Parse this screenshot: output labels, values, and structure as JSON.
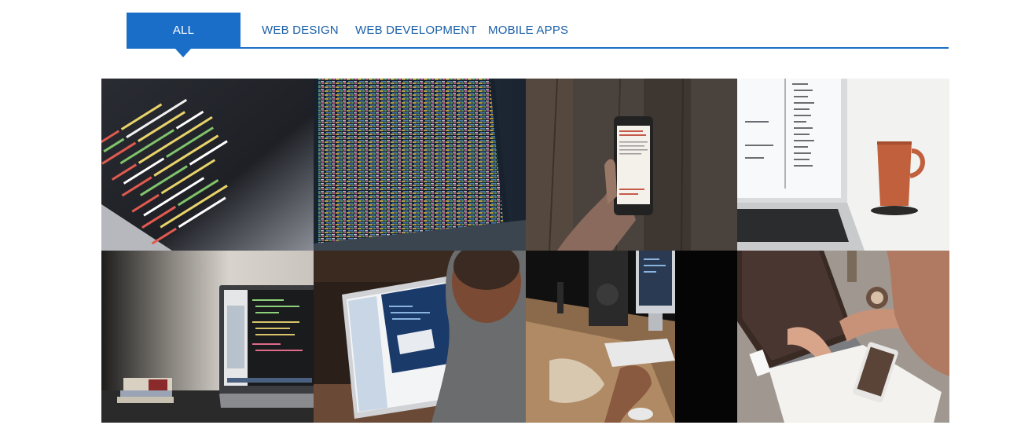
{
  "filters": [
    {
      "label": "ALL",
      "active": true
    },
    {
      "label": "WEB DESIGN",
      "active": false
    },
    {
      "label": "WEB DEVELOPMENT",
      "active": false
    },
    {
      "label": "MOBILE APPS",
      "active": false
    }
  ],
  "colors": {
    "accent": "#1a6ec7",
    "tab_text": "#1a5fa8",
    "background": "#ffffff"
  },
  "gallery": {
    "items": [
      {
        "subject": "code-editor-closeup-photo"
      },
      {
        "subject": "laptop-code-screen-photo"
      },
      {
        "subject": "hand-holding-phone-photo"
      },
      {
        "subject": "laptop-with-coffee-mug-photo"
      },
      {
        "subject": "laptop-on-desk-photo"
      },
      {
        "subject": "developer-at-laptop-photo"
      },
      {
        "subject": "desk-with-imac-photo"
      },
      {
        "subject": "typing-on-laptop-photo"
      }
    ]
  }
}
